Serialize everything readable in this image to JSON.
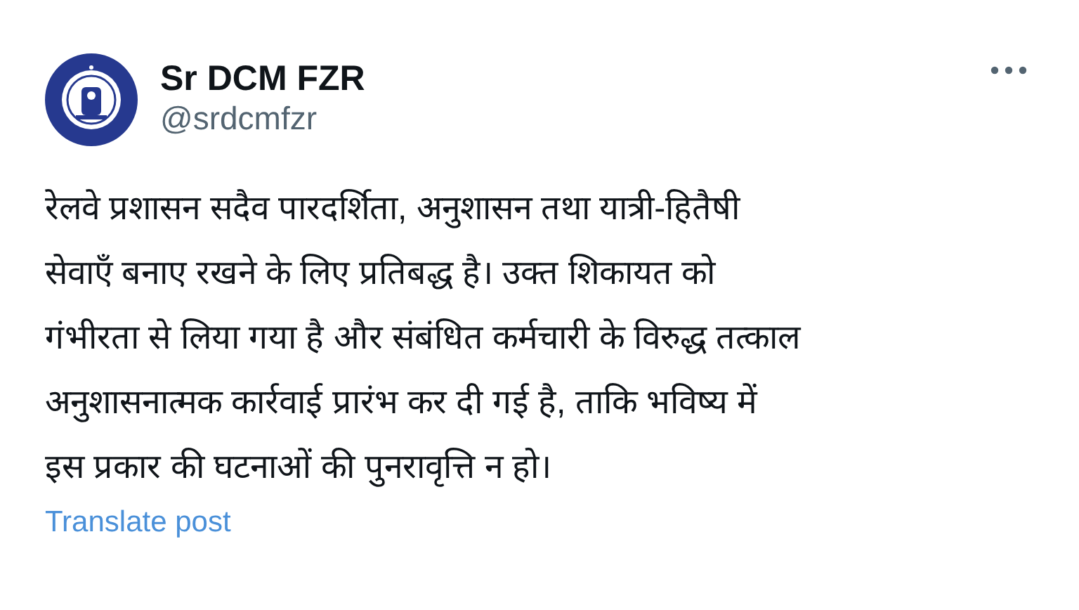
{
  "author": {
    "name": "Sr DCM FZR",
    "handle": "@srdcmfzr"
  },
  "post": {
    "text": "रेलवे प्रशासन सदैव पारदर्शिता, अनुशासन तथा यात्री-हितैषी\nसेवाएँ बनाए रखने के लिए प्रतिबद्ध है। उक्त शिकायत को\nगंभीरता से लिया गया है और संबंधित कर्मचारी के विरुद्ध तत्काल\nअनुशासनात्मक कार्रवाई प्रारंभ कर दी गई है, ताकि भविष्य में\nइस प्रकार की घटनाओं की पुनरावृत्ति न हो।"
  },
  "translate_link": "Translate post"
}
